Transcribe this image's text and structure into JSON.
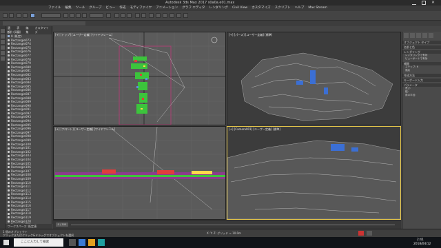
{
  "window": {
    "title": "Autodesk 3ds Max 2017    s0a0a.e01.max"
  },
  "menubar": {
    "items": [
      "ファイル",
      "編集",
      "ツール",
      "グループ",
      "ビュー",
      "作成",
      "モディファイヤ",
      "アニメーション",
      "グラフ エディタ",
      "レンダリング",
      "Civil View",
      "カスタマイズ",
      "スクリプト",
      "ヘルプ",
      "Max Stream"
    ]
  },
  "explorer": {
    "tabs": [
      "選択",
      "表示",
      "編集",
      "カスタマイズ"
    ],
    "header": "名前 (昇順)",
    "root": "0 (既定)",
    "items": [
      "Rectangle073",
      "Rectangle074",
      "Rectangle075",
      "Rectangle076",
      "Rectangle077",
      "Rectangle078",
      "Rectangle079",
      "Rectangle080",
      "Rectangle081",
      "Rectangle082",
      "Rectangle083",
      "Rectangle084",
      "Rectangle085",
      "Rectangle086",
      "Rectangle087",
      "Rectangle088",
      "Rectangle089",
      "Rectangle090",
      "Rectangle091",
      "Rectangle092",
      "Rectangle093",
      "Rectangle094",
      "Rectangle095",
      "Rectangle096",
      "Rectangle097",
      "Rectangle098",
      "Rectangle099",
      "Rectangle100",
      "Rectangle101",
      "Rectangle102",
      "Rectangle103",
      "Rectangle104",
      "Rectangle105",
      "Rectangle106",
      "Rectangle107",
      "Rectangle108",
      "Rectangle109",
      "Rectangle110",
      "Rectangle111",
      "Rectangle112",
      "Rectangle113",
      "Rectangle114",
      "Rectangle115",
      "Rectangle116",
      "Rectangle117",
      "Rectangle118",
      "Rectangle119",
      "Rectangle120",
      "Rectangle121"
    ],
    "footer": "ワークスペース: 既定値"
  },
  "viewports": {
    "top": "[+] [トップ] [ユーザー定義] [ワイヤフレーム]",
    "persp1": "[+] [パース] [ユーザー定義] [標準]",
    "front": "[+] [フロント] [ユーザー定義] [ワイヤフレーム]",
    "persp2": "[+] [Camera001] [ユーザー定義] [標準]"
  },
  "commandpanel": {
    "heads": [
      "パラメータ",
      "レンダリング",
      "補間",
      "作成方法",
      "キーボード入力"
    ],
    "buttons": [
      "オブジェクト タイプ",
      "名前と色"
    ],
    "lines": [
      "レンダリングで有効",
      "ビューポートで有効",
      "ステップ: 6",
      "適応",
      "長さ:",
      "幅:",
      "角の半径:"
    ]
  },
  "timeline": {
    "frame": "0 / 100"
  },
  "status": {
    "left": "1 個のオブジェクト",
    "right": "X: Y: Z: グリッド = 10.0m",
    "hint": "クリックまたはクリック&ドラッグでオブジェクトを選択"
  },
  "taskbar": {
    "search": "ここに入力して検索",
    "time": "2:41",
    "date": "2018/04/12"
  }
}
